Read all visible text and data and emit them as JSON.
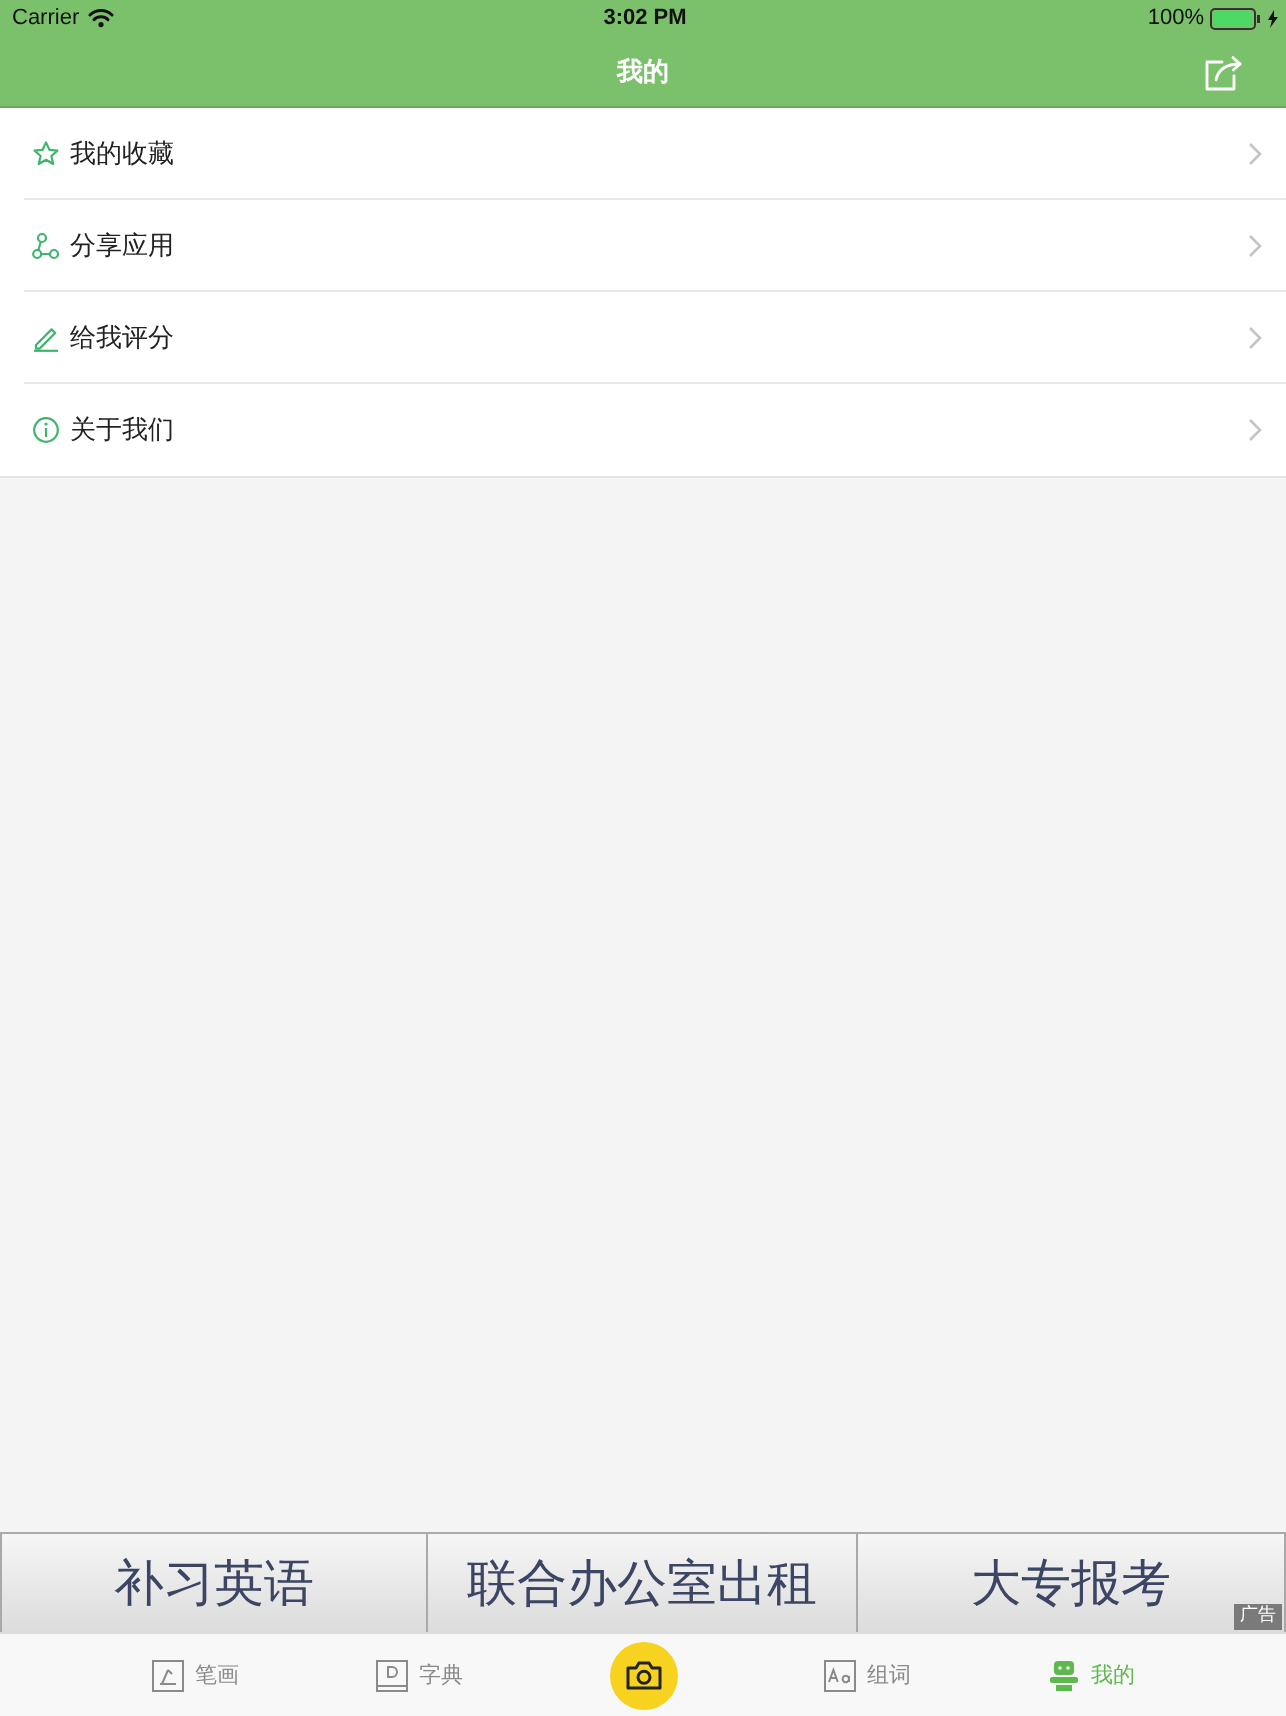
{
  "status_bar": {
    "carrier": "Carrier",
    "time": "3:02 PM",
    "battery": "100%"
  },
  "nav_bar": {
    "title": "我的"
  },
  "menu": [
    {
      "label": "我的收藏"
    },
    {
      "label": "分享应用"
    },
    {
      "label": "给我评分"
    },
    {
      "label": "关于我们"
    }
  ],
  "ad_banner": {
    "items": [
      {
        "text": "补习英语"
      },
      {
        "text": "联合办公室出租"
      },
      {
        "text": "大专报考"
      }
    ],
    "badge": "广告"
  },
  "tab_bar": [
    {
      "kind": "tab",
      "label": "笔画",
      "selected": false
    },
    {
      "kind": "tab",
      "label": "字典",
      "selected": false
    },
    {
      "kind": "camera",
      "selected": false
    },
    {
      "kind": "tab",
      "label": "组词",
      "selected": false
    },
    {
      "kind": "tab",
      "label": "我的",
      "selected": true
    }
  ]
}
